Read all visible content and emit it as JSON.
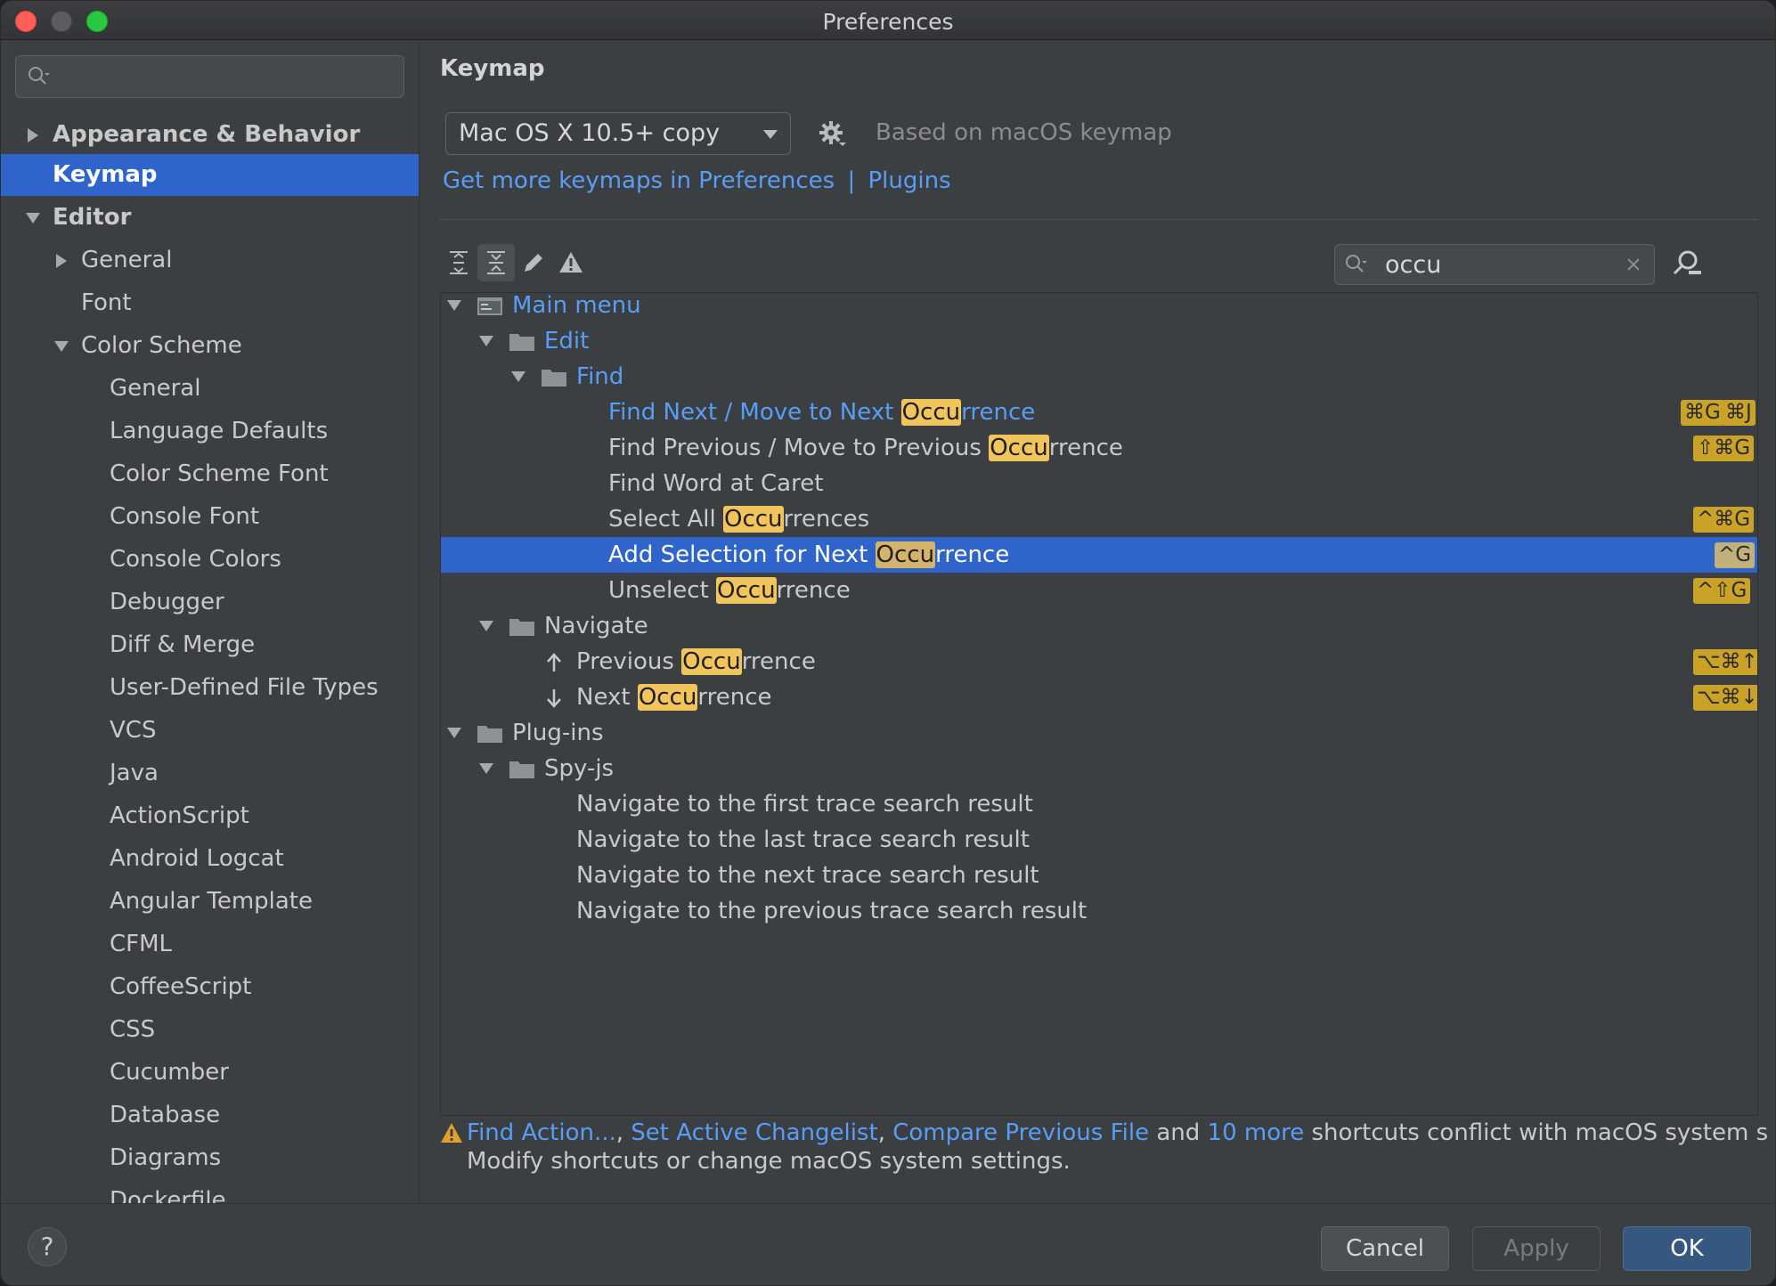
{
  "window": {
    "title": "Preferences"
  },
  "sidebar": {
    "search_placeholder": "",
    "items": [
      {
        "label": "Appearance & Behavior"
      },
      {
        "label": "Keymap"
      },
      {
        "label": "Editor"
      },
      {
        "label": "General"
      },
      {
        "label": "Font"
      },
      {
        "label": "Color Scheme"
      },
      {
        "label": "General"
      },
      {
        "label": "Language Defaults"
      },
      {
        "label": "Color Scheme Font"
      },
      {
        "label": "Console Font"
      },
      {
        "label": "Console Colors"
      },
      {
        "label": "Debugger"
      },
      {
        "label": "Diff & Merge"
      },
      {
        "label": "User-Defined File Types"
      },
      {
        "label": "VCS"
      },
      {
        "label": "Java"
      },
      {
        "label": "ActionScript"
      },
      {
        "label": "Android Logcat"
      },
      {
        "label": "Angular Template"
      },
      {
        "label": "CFML"
      },
      {
        "label": "CoffeeScript"
      },
      {
        "label": "CSS"
      },
      {
        "label": "Cucumber"
      },
      {
        "label": "Database"
      },
      {
        "label": "Diagrams"
      },
      {
        "label": "Dockerfile"
      }
    ]
  },
  "main": {
    "heading": "Keymap",
    "keymap_select": "Mac OS X 10.5+ copy",
    "based_on": "Based on macOS keymap",
    "more_link_a": "Get more keymaps in Preferences",
    "more_link_sep": "|",
    "more_link_b": "Plugins",
    "filter_value": "occu",
    "tree": {
      "main_menu": "Main menu",
      "edit": "Edit",
      "find": "Find",
      "r1_a": "Find Next / Move to Next ",
      "r1_hl": "Occu",
      "r1_b": "rrence",
      "r1_sc1": "⌘G",
      "r1_sc2": "⌘J",
      "r2_a": "Find Previous / Move to Previous ",
      "r2_hl": "Occu",
      "r2_b": "rrence",
      "r2_sc": "⇧⌘G",
      "r3": "Find Word at Caret",
      "r4_a": "Select All ",
      "r4_hl": "Occu",
      "r4_b": "rrences",
      "r4_sc": "^⌘G",
      "r5_a": "Add Selection for Next ",
      "r5_hl": "Occu",
      "r5_b": "rrence",
      "r5_sc": "^G",
      "r6_a": "Unselect ",
      "r6_hl": "Occu",
      "r6_b": "rrence",
      "r6_sc": "^⇧G",
      "navigate": "Navigate",
      "r7_a": "Previous ",
      "r7_hl": "Occu",
      "r7_b": "rrence",
      "r7_sc": "⌥⌘↑",
      "r8_a": "Next ",
      "r8_hl": "Occu",
      "r8_b": "rrence",
      "r8_sc": "⌥⌘↓",
      "plugins": "Plug-ins",
      "spyjs": "Spy-js",
      "s1": "Navigate to the first trace search result",
      "s2": "Navigate to the last trace search result",
      "s3": "Navigate to the next trace search result",
      "s4": "Navigate to the previous trace search result"
    },
    "warning": {
      "link1": "Find Action...",
      "comma1": ", ",
      "link2": "Set Active Changelist",
      "comma2": ", ",
      "link3": "Compare Previous File",
      "and": " and ",
      "link4": "10 more",
      "rest": " shortcuts conflict with macOS system s",
      "line2": "Modify shortcuts or change macOS system settings."
    }
  },
  "footer": {
    "help": "?",
    "cancel": "Cancel",
    "apply": "Apply",
    "ok": "OK"
  },
  "colors": {
    "accent": "#2f65ca",
    "link": "#589df6",
    "highlight": "#f2c55c"
  }
}
